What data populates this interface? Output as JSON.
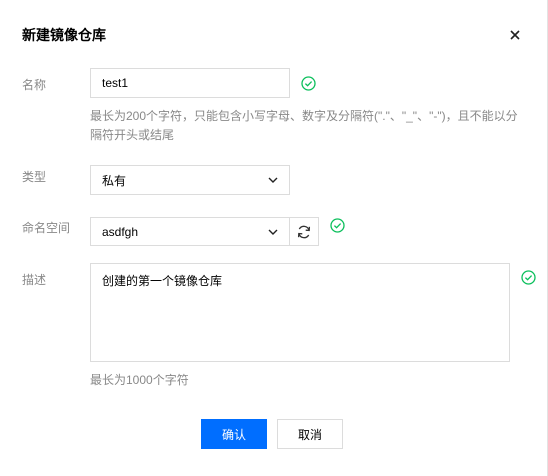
{
  "dialog": {
    "title": "新建镜像仓库",
    "close_icon": "close-icon"
  },
  "form": {
    "name": {
      "label": "名称",
      "value": "test1",
      "help": "最长为200个字符，只能包含小写字母、数字及分隔符(\".\"、\"_\"、\"-\")，且不能以分隔符开头或结尾"
    },
    "type": {
      "label": "类型",
      "value": "私有"
    },
    "namespace": {
      "label": "命名空间",
      "value": "asdfgh"
    },
    "description": {
      "label": "描述",
      "value": "创建的第一个镜像仓库",
      "help": "最长为1000个字符"
    }
  },
  "buttons": {
    "confirm": "确认",
    "cancel": "取消"
  },
  "colors": {
    "primary": "#006eff",
    "success": "#0abf5b",
    "label": "#888888",
    "border": "#dcdcdc"
  },
  "icons": [
    "close-icon",
    "check-circle-icon",
    "chevron-down-icon",
    "refresh-icon"
  ]
}
